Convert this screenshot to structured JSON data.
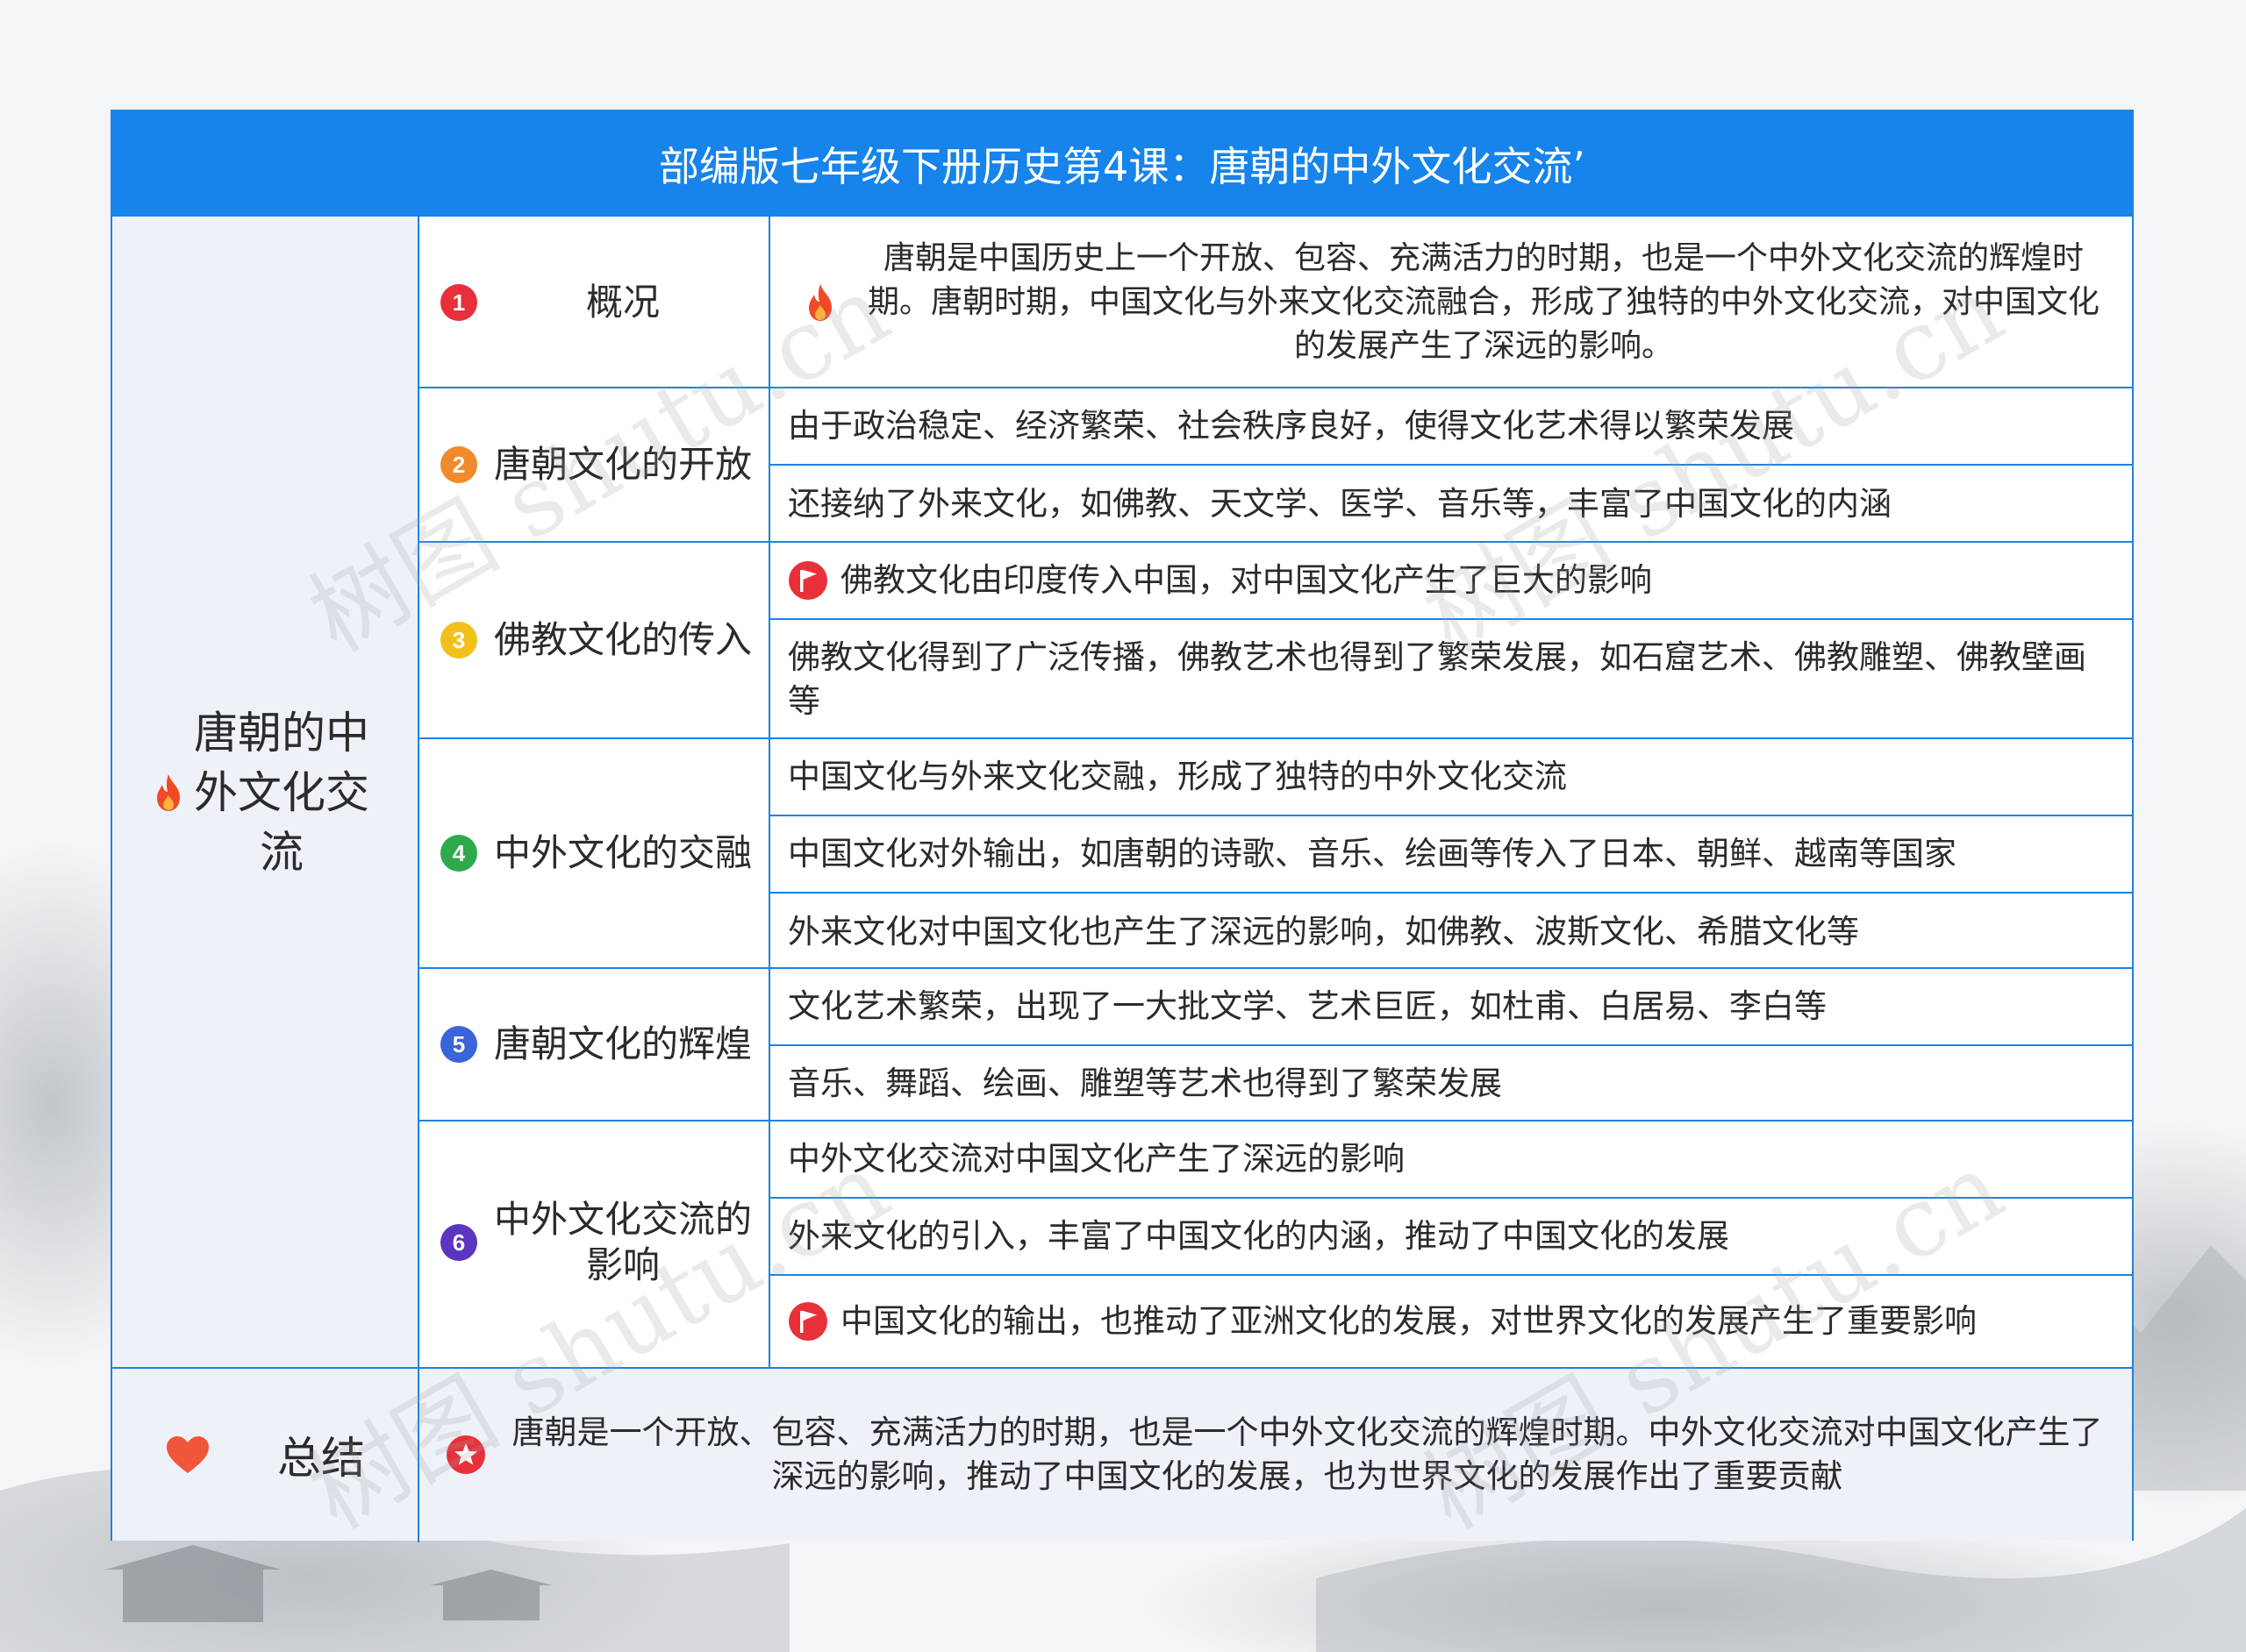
{
  "title": "部编版七年级下册历史第4课：唐朝的中外文化交流’",
  "root": {
    "label": "唐朝的中外文化交流",
    "icon": "fire-icon"
  },
  "sections": [
    {
      "num": "1",
      "label": "概况",
      "color": "#e8303b",
      "items": [
        "唐朝是中国历史上一个开放、包容、充满活力的时期，也是一个中外文化交流的辉煌时期。唐朝时期，中国文化与外来文化交流融合，形成了独特的中外文化交流，对中国文化的发展产生了深远的影响。"
      ]
    },
    {
      "num": "2",
      "label": "唐朝文化的开放",
      "color": "#f08a2c",
      "items": [
        "由于政治稳定、经济繁荣、社会秩序良好，使得文化艺术得以繁荣发展",
        "还接纳了外来文化，如佛教、天文学、医学、音乐等，丰富了中国文化的内涵"
      ]
    },
    {
      "num": "3",
      "label": "佛教文化的传入",
      "color": "#f2c01a",
      "items": [
        "佛教文化由印度传入中国，对中国文化产生了巨大的影响",
        "佛教文化得到了广泛传播，佛教艺术也得到了繁荣发展，如石窟艺术、佛教雕塑、佛教壁画等"
      ]
    },
    {
      "num": "4",
      "label": "中外文化的交融",
      "color": "#2eaa4c",
      "items": [
        "中国文化与外来文化交融，形成了独特的中外文化交流",
        "中国文化对外输出，如唐朝的诗歌、音乐、绘画等传入了日本、朝鲜、越南等国家",
        "外来文化对中国文化也产生了深远的影响，如佛教、波斯文化、希腊文化等"
      ]
    },
    {
      "num": "5",
      "label": "唐朝文化的辉煌",
      "color": "#3a64d8",
      "items": [
        "文化艺术繁荣，出现了一大批文学、艺术巨匠，如杜甫、白居易、李白等",
        "音乐、舞蹈、绘画、雕塑等艺术也得到了繁荣发展"
      ]
    },
    {
      "num": "6",
      "label": "中外文化交流的影响",
      "color": "#5b35c0",
      "items": [
        "中外文化交流对中国文化产生了深远的影响",
        "外来文化的引入，丰富了中国文化的内涵，推动了中国文化的发展",
        "中国文化的输出，也推动了亚洲文化的发展，对世界文化的发展产生了重要影响"
      ]
    }
  ],
  "summary": {
    "label": "总结",
    "text": "唐朝是一个开放、包容、充满活力的时期，也是一个中外文化交流的辉煌时期。中外文化交流对中国文化产生了深远的影响，推动了中国文化的发展，也为世界文化的发展作出了重要贡献"
  },
  "watermark": "树图 shutu.cn"
}
